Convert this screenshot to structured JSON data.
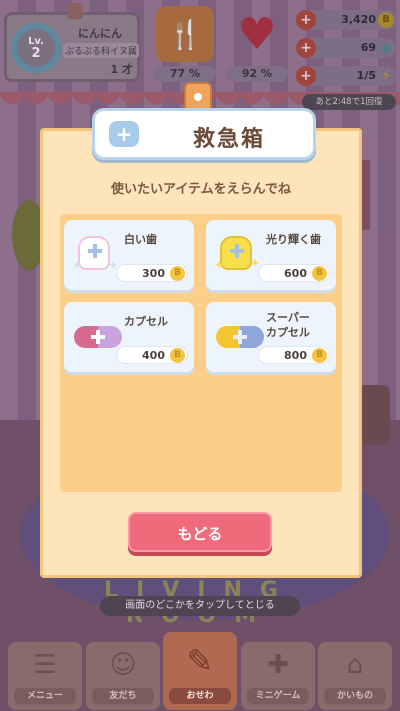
{
  "hud": {
    "level_label": "Lv.",
    "level": "2",
    "pet_name": "にんにん",
    "pet_breed": "ぷるぷる科イヌ属",
    "pet_age": "1 才",
    "hunger_pct": "77 %",
    "happiness_pct": "92 %",
    "coins": "3,420",
    "gems": "69",
    "energy": "1/5",
    "energy_timer": "あと2:48で1回復"
  },
  "dialog": {
    "title": "救急箱",
    "subtitle": "使いたいアイテムをえらんでね",
    "items": [
      {
        "name": "白い歯",
        "price": "300"
      },
      {
        "name": "光り輝く歯",
        "price": "600"
      },
      {
        "name": "カプセル",
        "price": "400"
      },
      {
        "name": "スーパー\nカプセル",
        "price": "800"
      }
    ],
    "back_label": "もどる",
    "close_hint": "画面のどこかをタップしてとじる"
  },
  "nav": {
    "items": [
      {
        "label": "メニュー",
        "icon": "menu-icon"
      },
      {
        "label": "友だち",
        "icon": "friends-icon"
      },
      {
        "label": "おせわ",
        "icon": "brush-icon"
      },
      {
        "label": "ミニゲーム",
        "icon": "gamepad-icon"
      },
      {
        "label": "かいもの",
        "icon": "shop-icon"
      }
    ]
  },
  "colors": {
    "dialog_bg": "#fde4bb",
    "back_button": "#ef6a7a",
    "coin": "#f4c542"
  }
}
